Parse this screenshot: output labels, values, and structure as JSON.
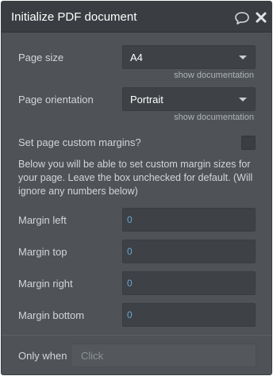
{
  "header": {
    "title": "Initialize PDF document",
    "icons": [
      "comment-icon",
      "close-icon"
    ]
  },
  "page_size": {
    "label": "Page size",
    "value": "A4",
    "doc_link": "show documentation"
  },
  "page_orientation": {
    "label": "Page orientation",
    "value": "Portrait",
    "doc_link": "show documentation"
  },
  "custom_margins": {
    "label": "Set page custom margins?",
    "checked": false,
    "description": "Below you will be able to set custom margin sizes for your page. Leave the box unchecked for default. (Will ignore any numbers below)"
  },
  "margins": [
    {
      "label": "Margin left",
      "value": "0"
    },
    {
      "label": "Margin top",
      "value": "0"
    },
    {
      "label": "Margin right",
      "value": "0"
    },
    {
      "label": "Margin bottom",
      "value": "0"
    }
  ],
  "only_when": {
    "label": "Only when",
    "placeholder": "Click"
  },
  "colors": {
    "panel_bg": "#4f5357",
    "header_bg": "#3a3d41",
    "input_bg": "#3e4145",
    "number_text": "#6aa5d6"
  }
}
